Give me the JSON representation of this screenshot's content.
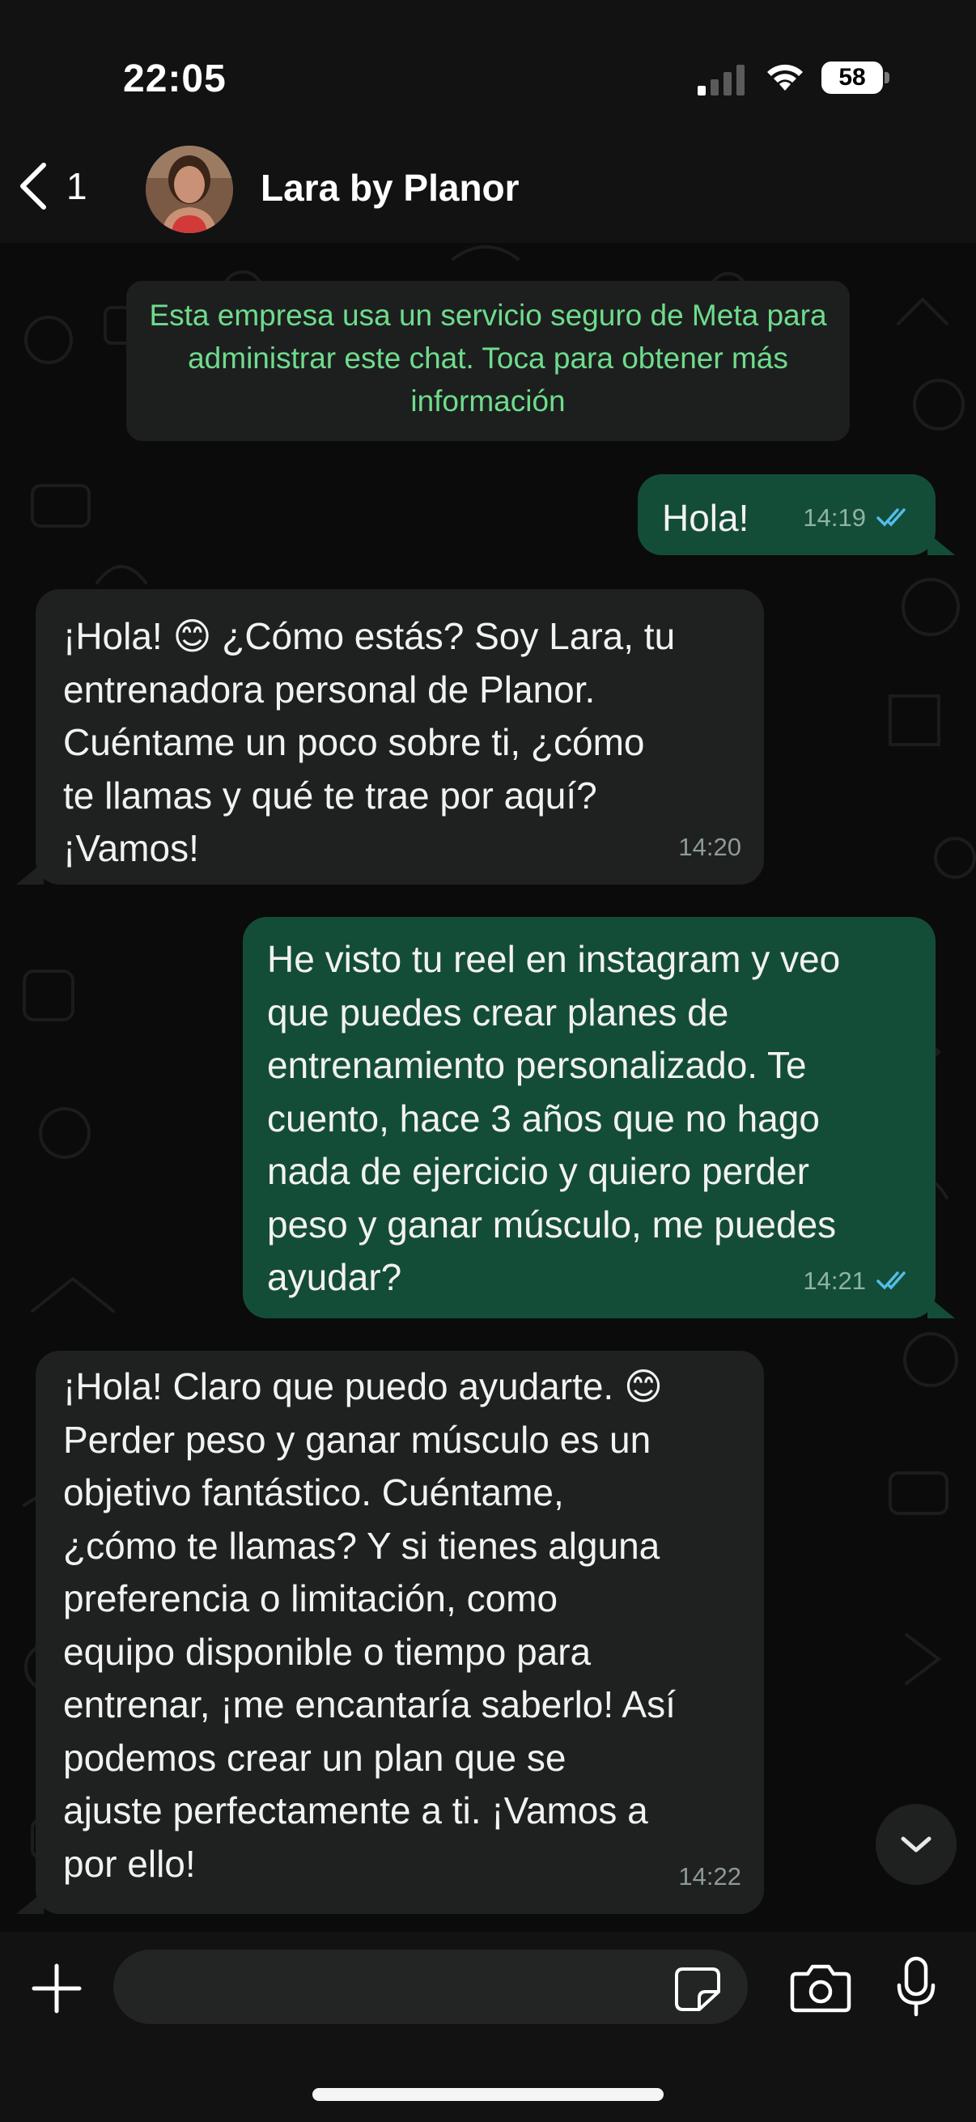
{
  "status_bar": {
    "time": "22:05",
    "battery": "58",
    "icons": [
      "signal-icon",
      "wifi-icon",
      "battery-icon"
    ]
  },
  "header": {
    "back_count": "1",
    "contact_name": "Lara by Planor",
    "icons": [
      "chevron-left-icon",
      "avatar"
    ]
  },
  "chat": {
    "notice": "Esta empresa usa un servicio seguro de Meta para administrar este chat. Toca para obtener más información",
    "messages": [
      {
        "direction": "outgoing",
        "text": "Hola!",
        "time": "14:19",
        "status": "read"
      },
      {
        "direction": "incoming",
        "text": "¡Hola! 😊 ¿Cómo estás? Soy Lara, tu\nentrenadora personal de Planor.\nCuéntame un poco sobre ti, ¿cómo\nte llamas y qué te trae por aquí?\n¡Vamos!",
        "time": "14:20"
      },
      {
        "direction": "outgoing",
        "text": "He visto tu reel en instagram y veo\nque puedes crear planes de\nentrenamiento personalizado. Te\ncuento, hace 3 años que no hago\nnada de ejercicio y quiero perder\npeso y ganar músculo, me puedes\nayudar?",
        "time": "14:21",
        "status": "read"
      },
      {
        "direction": "incoming",
        "text": "¡Hola! Claro que puedo ayudarte. 😊\nPerder peso y ganar músculo es un\nobjetivo fantástico. Cuéntame,\n¿cómo te llamas? Y si tienes alguna\npreferencia o limitación, como\nequipo disponible o tiempo para\nentrenar, ¡me encantaría saberlo! Así\npodemos crear un plan que se\najuste perfectamente a ti. ¡Vamos a\npor ello!",
        "time": "14:22"
      }
    ]
  },
  "input_bar": {
    "placeholder": "",
    "icons": [
      "plus-icon",
      "sticker-icon",
      "camera-icon",
      "microphone-icon"
    ]
  },
  "colors": {
    "background": "#0b0b0b",
    "bar": "#121212",
    "outgoing_bubble": "#144d37",
    "incoming_bubble": "#1f2121",
    "notice_text": "#6fdc8c",
    "read_ticks": "#53bdeb"
  }
}
